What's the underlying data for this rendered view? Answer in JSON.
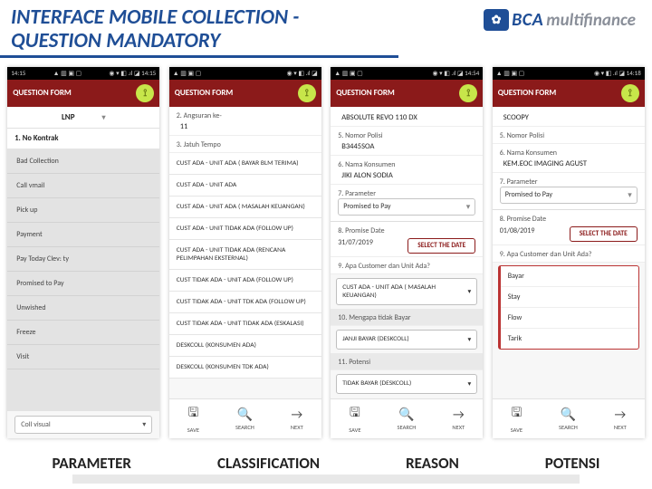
{
  "slide": {
    "title": "INTERFACE MOBILE COLLECTION - QUESTION MANDATORY",
    "logo": {
      "badge": "✿",
      "text1": "BCA",
      "text2": "multifinance"
    }
  },
  "phones": [
    {
      "status": {
        "time": "14:15",
        "icons": "▲ ▥ ▣ ▢",
        "right": "◉ ▾ ◧ .ıl ◪ 14:15"
      },
      "appbar": "QUESTION FORM",
      "lnp": "LNP",
      "first_q": "1. No Kontrak",
      "options": [
        "Bad Collection",
        "Call vmail",
        "Pick up",
        "Payment",
        "Pay Today Clev: ty",
        "Promised to Pay",
        "Unwished",
        "Freeze",
        "Visit"
      ],
      "select": "Coll visual"
    },
    {
      "status": {
        "time": "",
        "icons": "▲ ▥ ▣ ▢",
        "right": "◉ ▾ ◧ .ıl ◪"
      },
      "appbar": "QUESTION FORM",
      "q2": {
        "label": "2. Angsuran ke-",
        "value": "11"
      },
      "q3": {
        "label": "3. Jatuh Tempo"
      },
      "options": [
        "CUST ADA - UNIT ADA ( BAYAR BLM TERIMA)",
        "CUST ADA - UNIT ADA",
        "CUST ADA - UNIT ADA ( MASALAH KEUANGAN)",
        "CUST ADA - UNIT TIDAK ADA (FOLLOW UP)",
        "CUST ADA - UNIT TIDAK ADA (RENCANA PELIMPAHAN EKSTERNAL)",
        "CUST TIDAK ADA - UNIT ADA (FOLLOW UP)",
        "CUST TIDAK ADA - UNIT TDK ADA (FOLLOW UP)",
        "CUST TIDAK ADA - UNIT TIDAK ADA (ESKALASI)",
        "DESKCOLL (KONSUMEN ADA)",
        "DESKCOLL (KONSUMEN TDK ADA)"
      ],
      "bottom": {
        "save": "SAVE",
        "search": "SEARCH",
        "next": "NEXT"
      }
    },
    {
      "status": {
        "time": "",
        "icons": "▲ ▥ ▣ ▢",
        "right": "◉ ▾ ◧ .ıl ◪ 14:54"
      },
      "appbar": "QUESTION FORM",
      "unit": "ABSOLUTE REVO 110 DX",
      "q5": {
        "label": "5. Nomor Polisi",
        "value": "B3445SOA"
      },
      "q6": {
        "label": "6. Nama Konsumen",
        "value": "JIKI ALON SODIA"
      },
      "q7": {
        "label": "7. Parameter",
        "value": "Promised to Pay"
      },
      "q8": {
        "label": "8. Promise Date",
        "value": "31/07/2019",
        "btn": "SELECT THE DATE"
      },
      "q9": {
        "label": "9. Apa Customer dan Unit Ada?",
        "value": "CUST ADA - UNIT ADA ( MASALAH KEUANGAN)"
      },
      "q10": {
        "label": "10. Mengapa tidak Bayar",
        "value": "JANJI BAYAR (DESKCOLL)"
      },
      "q11": {
        "label": "11. Potensi",
        "value": "TIDAK BAYAR (DESKCOLL)"
      },
      "bottom": {
        "save": "SAVE",
        "search": "SEARCH",
        "next": "NEXT"
      }
    },
    {
      "status": {
        "time": "",
        "icons": "▲ ▥ ▣ ▢",
        "right": "◉ ▾ ◧ .ıl ◪ 14:18"
      },
      "appbar": "QUESTION FORM",
      "unit": "SCOOPY",
      "q5": {
        "label": "5. Nomor Polisi"
      },
      "q6": {
        "label": "6. Nama Konsumen",
        "value": "KEM.EOC IMAGING AGUST"
      },
      "q7": {
        "label": "7. Parameter",
        "value": "Promised to Pay"
      },
      "q8": {
        "label": "8. Promise Date",
        "value": "01/08/2019",
        "btn": "SELECT THE DATE"
      },
      "q9": {
        "label": "9. Apa Customer dan Unit Ada?"
      },
      "potensi_items": [
        "Bayar",
        "Stay",
        "Flow",
        "Tarik"
      ],
      "bottom": {
        "save": "SAVE",
        "search": "SEARCH",
        "next": "NEXT"
      }
    }
  ],
  "labels": {
    "p1": "PARAMETER",
    "p2": "CLASSIFICATION",
    "p3": "REASON",
    "p4": "POTENSI"
  }
}
